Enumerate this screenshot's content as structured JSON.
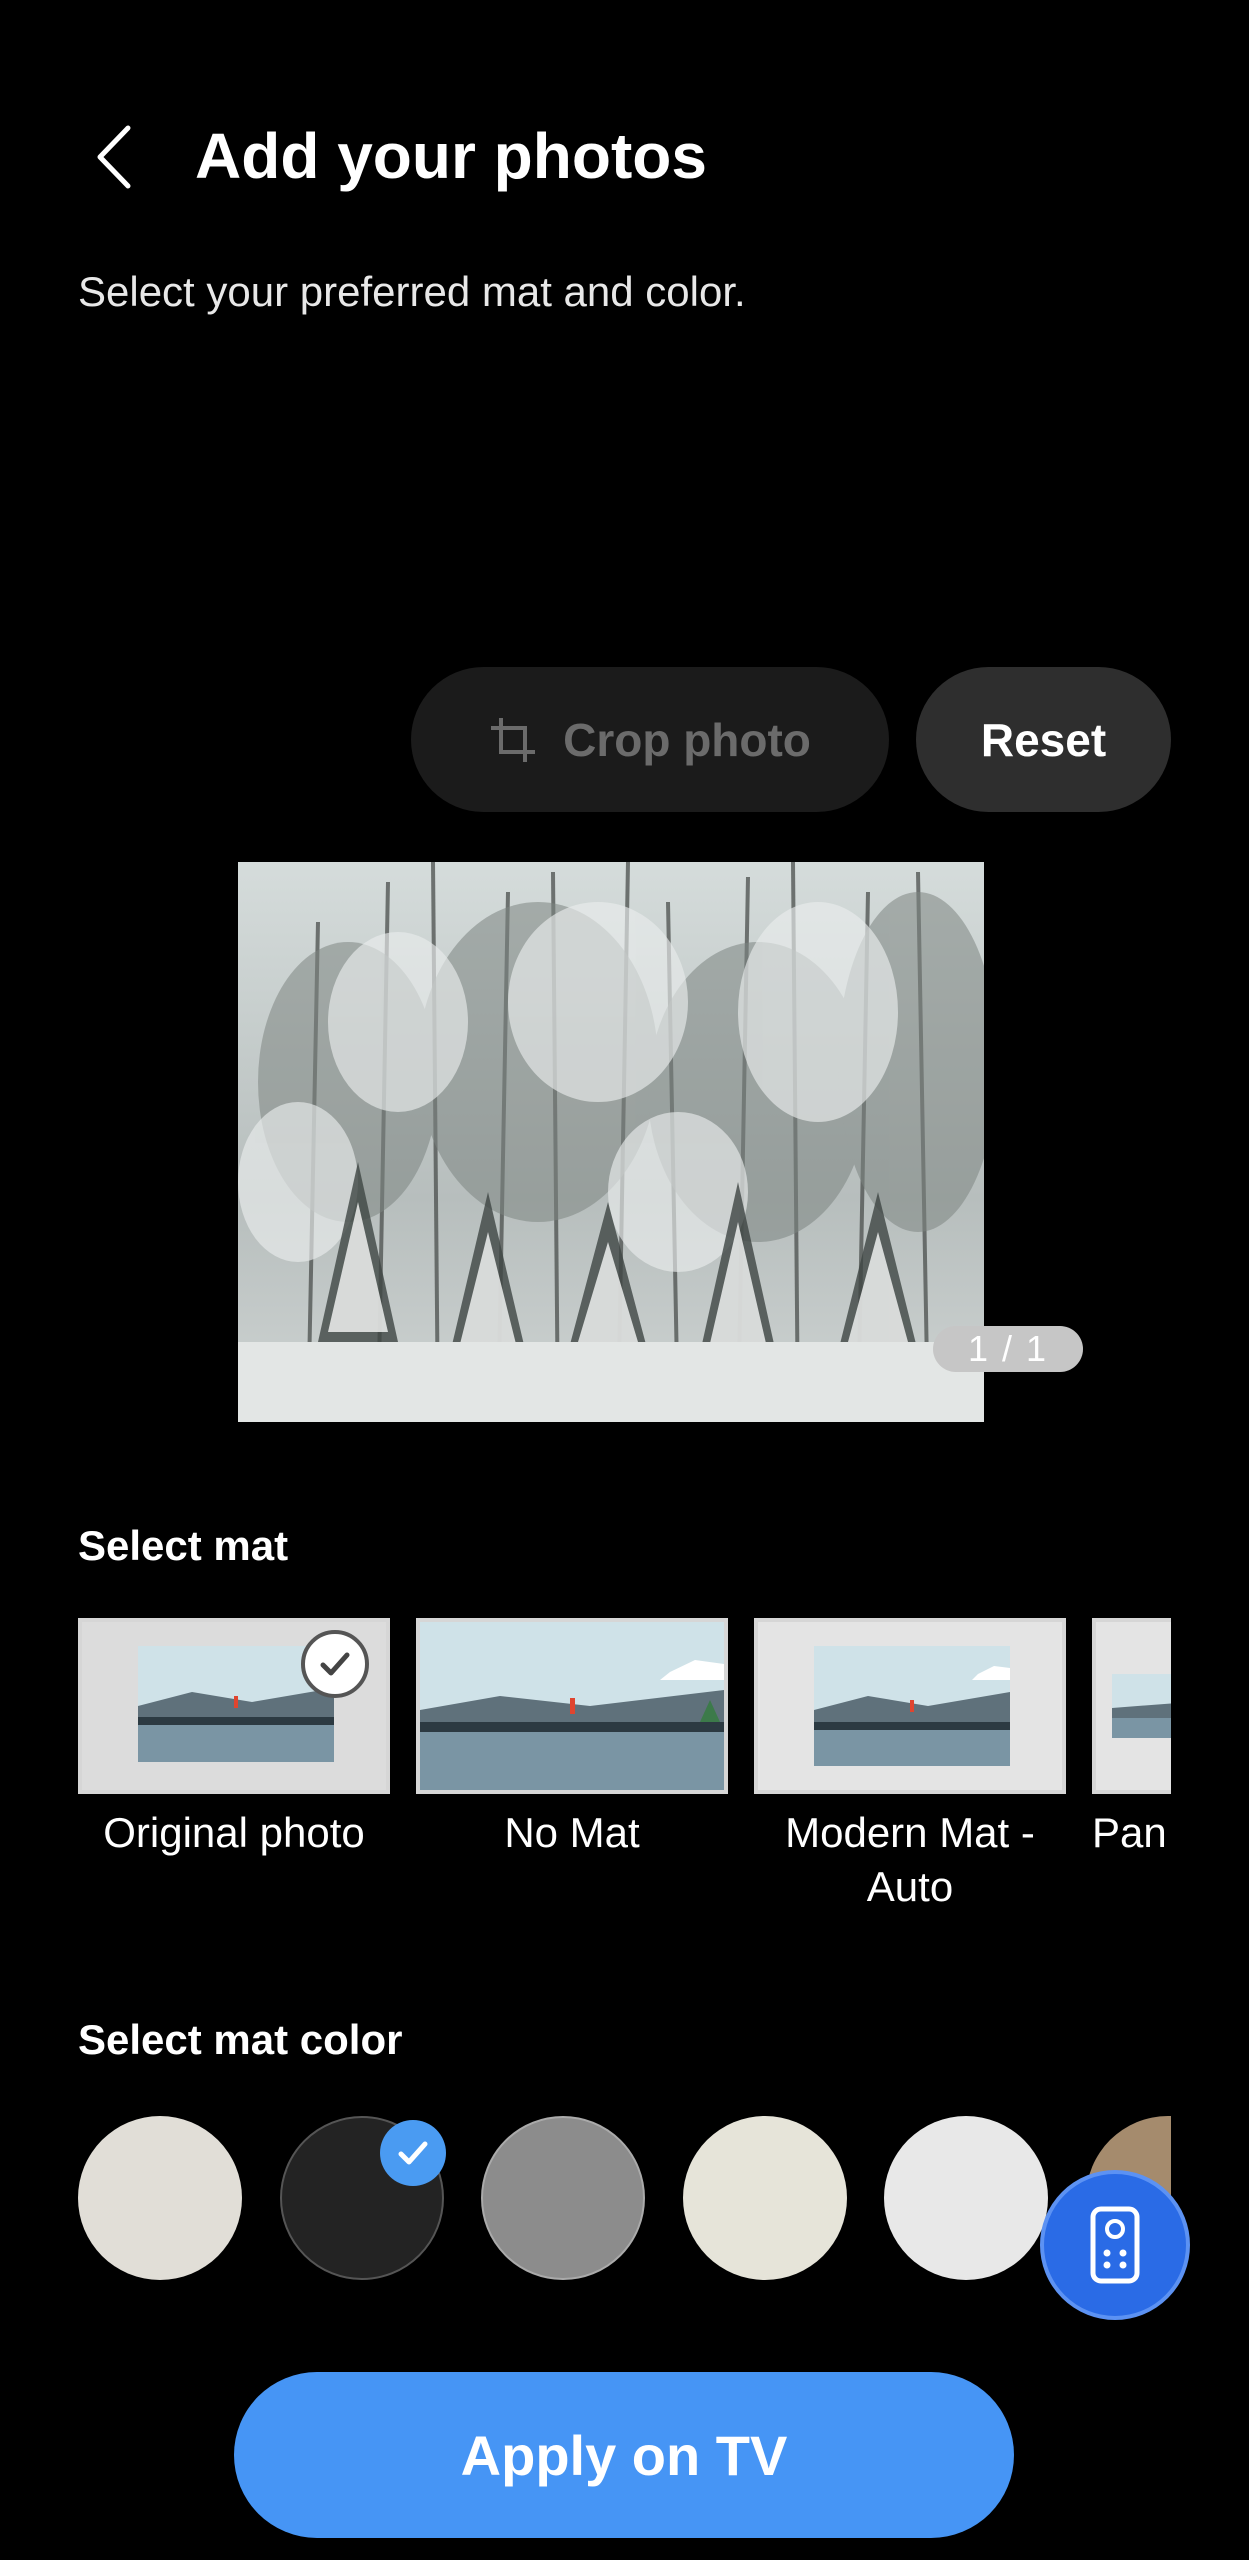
{
  "header": {
    "title": "Add your photos",
    "back_icon": "chevron-left-icon"
  },
  "subtitle": "Select your preferred mat and color.",
  "toolbar": {
    "crop_label": "Crop photo",
    "crop_icon": "crop-icon",
    "reset_label": "Reset"
  },
  "preview": {
    "image": "snowy-forest-photo",
    "page_indicator": "1 / 1"
  },
  "mat_section": {
    "label": "Select mat",
    "options": [
      {
        "name": "Original photo",
        "selected": true
      },
      {
        "name": "No Mat",
        "selected": false
      },
      {
        "name": "Modern Mat - Auto",
        "selected": false
      },
      {
        "name": "Pan",
        "selected": false
      }
    ]
  },
  "color_section": {
    "label": "Select mat color",
    "swatches": [
      {
        "color": "#e1ded7",
        "selected": false
      },
      {
        "color": "#232323",
        "selected": true
      },
      {
        "color": "#8c8c8c",
        "selected": false
      },
      {
        "color": "#e6e4d9",
        "selected": false
      },
      {
        "color": "#e8e8e8",
        "selected": false
      },
      {
        "color": "#a58b6d",
        "selected": false
      }
    ]
  },
  "remote_button": {
    "icon": "tv-remote-icon"
  },
  "apply_label": "Apply on TV",
  "colors": {
    "accent": "#4695f5",
    "check": "#4a9bf2",
    "fab": "#2a6be6"
  }
}
